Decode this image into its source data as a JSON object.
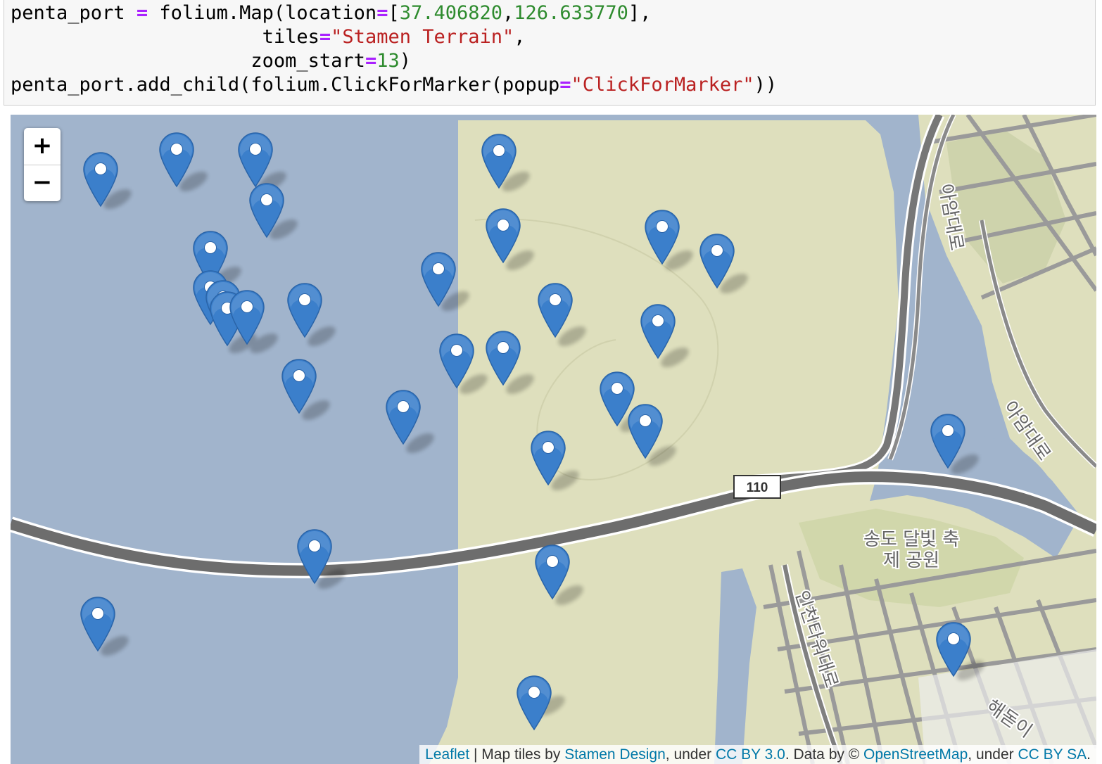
{
  "code": {
    "line1": {
      "prefix": "penta_port ",
      "eq": "=",
      "call": " folium.Map(location",
      "eq2": "=",
      "bracket_open": "[",
      "lat": "37.406820",
      "comma": ",",
      "lon": "126.633770",
      "bracket_close": "],"
    },
    "line2": {
      "indent": "                      ",
      "key": "tiles",
      "eq": "=",
      "value": "\"Stamen Terrain\"",
      "tail": ","
    },
    "line3": {
      "indent": "                     ",
      "key": "zoom_start",
      "eq": "=",
      "value": "13",
      "tail": ")"
    },
    "line4": {
      "prefix": "penta_port.add_child(folium.ClickForMarker(popup",
      "eq": "=",
      "value": "\"ClickForMarker\"",
      "tail": "))"
    }
  },
  "map": {
    "zoom_in_label": "+",
    "zoom_out_label": "−",
    "route_shield": "110",
    "labels": {
      "road_east": "아암대로",
      "road_east2": "아암대로",
      "park_1": "송도 달빛 축",
      "park_2": "제 공원",
      "road_south": "인천타워대로",
      "road_se": "해돋이"
    },
    "marker_count": 30,
    "colors": {
      "sea": "#a1b4cc",
      "land": "#dedfbd",
      "marker": "#3b7fcb"
    },
    "attribution": {
      "leaflet": "Leaflet",
      "sep": " | Map tiles by ",
      "stamen": "Stamen Design",
      "under1": ", under ",
      "ccby": "CC BY 3.0",
      "data_by": ". Data by © ",
      "osm": "OpenStreetMap",
      "under2": ", under ",
      "ccbysa": "CC BY SA",
      "end": "."
    }
  }
}
